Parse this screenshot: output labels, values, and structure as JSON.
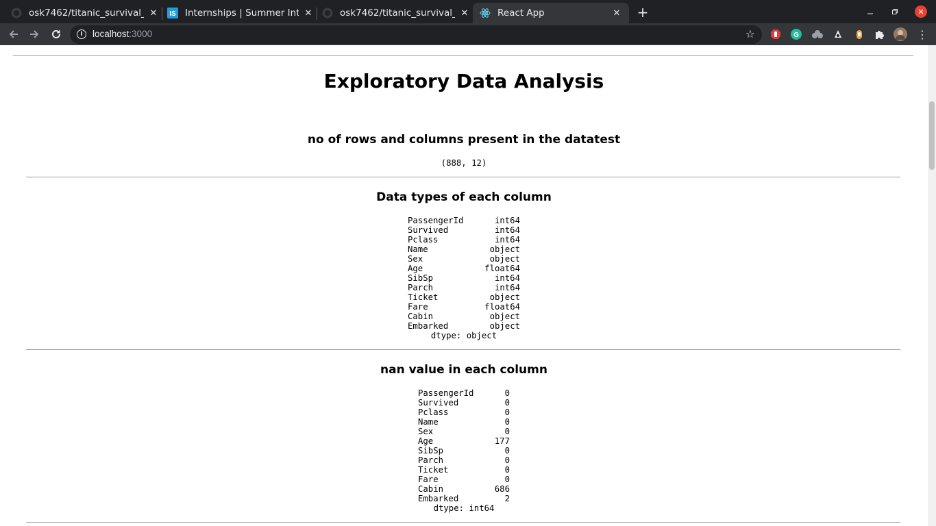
{
  "browser": {
    "tabs": [
      {
        "title": "osk7462/titanic_survival_",
        "icon": "github-icon"
      },
      {
        "title": "Internships | Summer Inte",
        "icon": "internshala-icon"
      },
      {
        "title": "osk7462/titanic_survival_",
        "icon": "github-icon"
      },
      {
        "title": "React App",
        "icon": "react-icon"
      }
    ],
    "new_tab": "+",
    "url_host": "localhost",
    "url_port": ":3000",
    "extensions": [
      "adblock-icon",
      "grammarly-icon",
      "extension-icon",
      "extension-icon",
      "extension-icon",
      "puzzle-icon",
      "profile-avatar"
    ]
  },
  "main": {
    "title": "Exploratory Data Analysis",
    "shape_section": {
      "heading": "no of rows and columns present in the datatest",
      "value": "(888, 12)"
    },
    "dtypes_section": {
      "heading": "Data types of each column",
      "rows": [
        {
          "name": "PassengerId",
          "value": "int64"
        },
        {
          "name": "Survived",
          "value": "int64"
        },
        {
          "name": "Pclass",
          "value": "int64"
        },
        {
          "name": "Name",
          "value": "object"
        },
        {
          "name": "Sex",
          "value": "object"
        },
        {
          "name": "Age",
          "value": "float64"
        },
        {
          "name": "SibSp",
          "value": "int64"
        },
        {
          "name": "Parch",
          "value": "int64"
        },
        {
          "name": "Ticket",
          "value": "object"
        },
        {
          "name": "Fare",
          "value": "float64"
        },
        {
          "name": "Cabin",
          "value": "object"
        },
        {
          "name": "Embarked",
          "value": "object"
        }
      ],
      "dtype": "dtype: object"
    },
    "nan_section": {
      "heading": "nan value in each column",
      "rows": [
        {
          "name": "PassengerId",
          "value": "0"
        },
        {
          "name": "Survived",
          "value": "0"
        },
        {
          "name": "Pclass",
          "value": "0"
        },
        {
          "name": "Name",
          "value": "0"
        },
        {
          "name": "Sex",
          "value": "0"
        },
        {
          "name": "Age",
          "value": "177"
        },
        {
          "name": "SibSp",
          "value": "0"
        },
        {
          "name": "Parch",
          "value": "0"
        },
        {
          "name": "Ticket",
          "value": "0"
        },
        {
          "name": "Fare",
          "value": "0"
        },
        {
          "name": "Cabin",
          "value": "686"
        },
        {
          "name": "Embarked",
          "value": "2"
        }
      ],
      "dtype": "dtype: int64"
    }
  }
}
